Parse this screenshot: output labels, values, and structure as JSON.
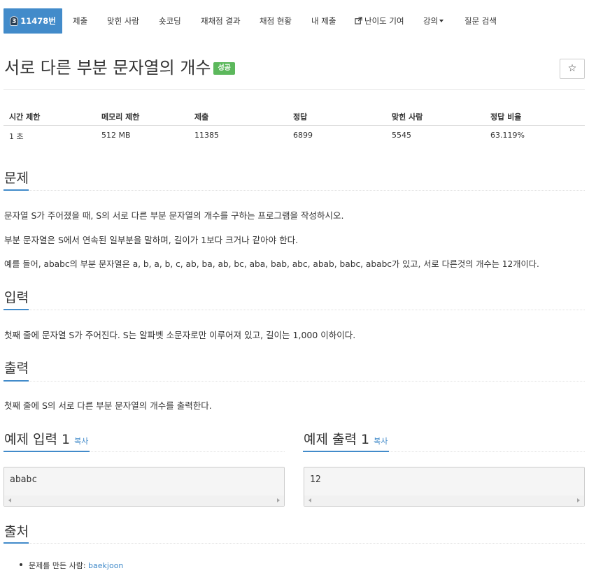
{
  "nav": {
    "problem_tier": "3",
    "problem_id": "11478번",
    "items": [
      "제출",
      "맞힌 사람",
      "숏코딩",
      "재채점 결과",
      "채점 현황",
      "내 제출",
      "난이도 기여",
      "강의",
      "질문 검색"
    ]
  },
  "problem": {
    "title": "서로 다른 부분 문자열의 개수",
    "status_badge": "성공",
    "star_icon": "☆"
  },
  "info": {
    "headers": [
      "시간 제한",
      "메모리 제한",
      "제출",
      "정답",
      "맞힌 사람",
      "정답 비율"
    ],
    "values": [
      "1 초",
      "512 MB",
      "11385",
      "6899",
      "5545",
      "63.119%"
    ]
  },
  "sections": {
    "description_title": "문제",
    "description": [
      "문자열 S가 주어졌을 때, S의 서로 다른 부분 문자열의 개수를 구하는 프로그램을 작성하시오.",
      "부분 문자열은 S에서 연속된 일부분을 말하며, 길이가 1보다 크거나 같아야 한다.",
      "예를 들어, ababc의 부분 문자열은 a, b, a, b, c, ab, ba, ab, bc, aba, bab, abc, abab, babc, ababc가 있고, 서로 다른것의 개수는 12개이다."
    ],
    "input_title": "입력",
    "input": "첫째 줄에 문자열 S가 주어진다. S는 알파벳 소문자로만 이루어져 있고, 길이는 1,000 이하이다.",
    "output_title": "출력",
    "output": "첫째 줄에 S의 서로 다른 부분 문자열의 개수를 출력한다.",
    "sample_input_title": "예제 입력 1",
    "sample_output_title": "예제 출력 1",
    "copy_label": "복사",
    "sample_input": "ababc",
    "sample_output": "12",
    "source_title": "출처",
    "source_prefix": "문제를 만든 사람: ",
    "source_author": "baekjoon"
  },
  "colors": {
    "accent": "#428bca",
    "success": "#5cb85c"
  }
}
